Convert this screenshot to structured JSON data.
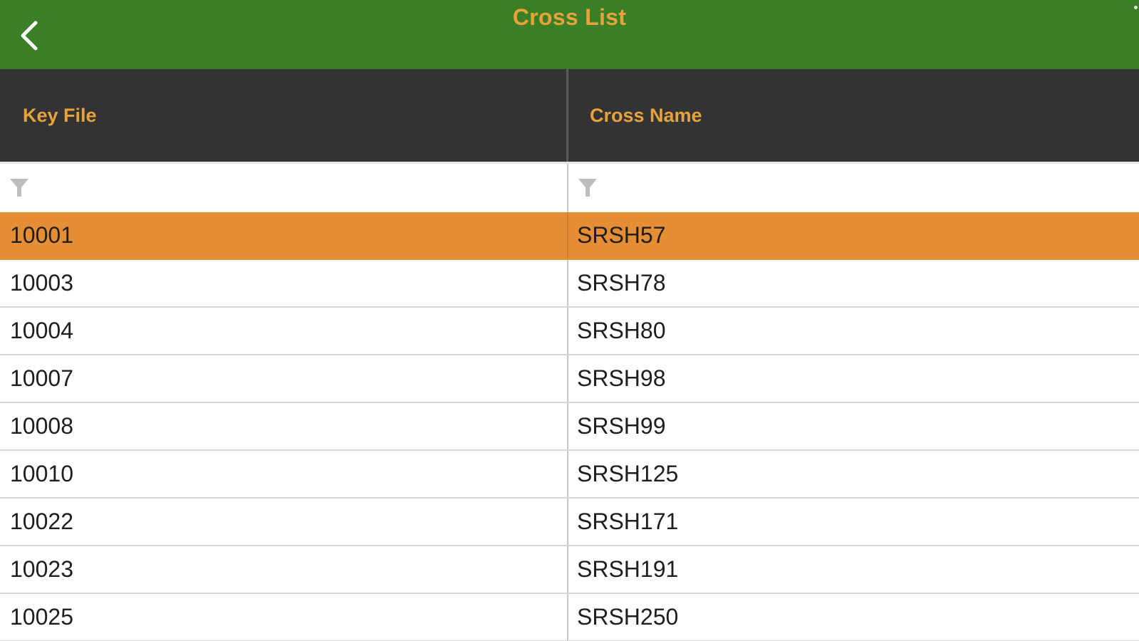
{
  "nav": {
    "title": "Cross List",
    "back_icon": "chevron-left-icon"
  },
  "colors": {
    "nav_background": "#3a7f26",
    "accent_text": "#e8a23c",
    "header_background": "#333333",
    "selected_row": "#e68e35"
  },
  "table": {
    "columns": [
      {
        "label": "Key File"
      },
      {
        "label": "Cross Name"
      }
    ],
    "filter_icon": "filter-icon",
    "selected_row_index": 0,
    "rows": [
      {
        "key_file": "10001",
        "cross_name": "SRSH57"
      },
      {
        "key_file": "10003",
        "cross_name": "SRSH78"
      },
      {
        "key_file": "10004",
        "cross_name": "SRSH80"
      },
      {
        "key_file": "10007",
        "cross_name": "SRSH98"
      },
      {
        "key_file": "10008",
        "cross_name": "SRSH99"
      },
      {
        "key_file": "10010",
        "cross_name": "SRSH125"
      },
      {
        "key_file": "10022",
        "cross_name": "SRSH171"
      },
      {
        "key_file": "10023",
        "cross_name": "SRSH191"
      },
      {
        "key_file": "10025",
        "cross_name": "SRSH250"
      }
    ]
  }
}
